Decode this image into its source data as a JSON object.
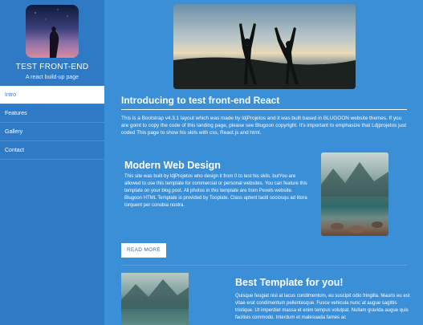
{
  "sidebar": {
    "title": "TEST FRONT-END",
    "subtitle": "A react build-up page",
    "items": [
      {
        "label": "Intro"
      },
      {
        "label": "Features"
      },
      {
        "label": "Gallery"
      },
      {
        "label": "Contact"
      }
    ]
  },
  "intro": {
    "title": "Introducing to test front-end React",
    "text": "This is a Bootstrap v4.3.1 layout which was made by ldjProjetos and it was built based in BLUGOON website themes. If you are goint to copy the code of this landing page, please see Blugoon copyright. It's important to emphasize that Ldjprojetos just coded This page to show his skils with css, React.js and html."
  },
  "card1": {
    "title": "Modern Web Design",
    "text": "This site was built by ldjProjetos who design it from 0 to test his skils. butYou are allowed to use this template for commercial or personal websites. You can feature this template on your blog post. All photos in this template are from Pexels website. Blugoon HTML Template is provided by Tooplate. Class aptent taciti sociosqu ad litora torquent per conubia nostra.",
    "button": "READ MORE"
  },
  "card2": {
    "title": "Best Template for you!",
    "text": "Quisque feugiat nisl at lacus condimentum, eu suscipit odio fringilla. Mauris eu est vitae erat condimentum pellentesque. Fusce vehicula nunc at augue sagittis tristique. Ut imperdiet massa et enim tempus volutpat. Nullam gravida augue quis facilisis commodo. Interdum et malesuada fames ac"
  },
  "colors": {
    "background": "#3a8fd6",
    "sidebar": "#2f7ac4",
    "active_nav": "#ffffff"
  }
}
